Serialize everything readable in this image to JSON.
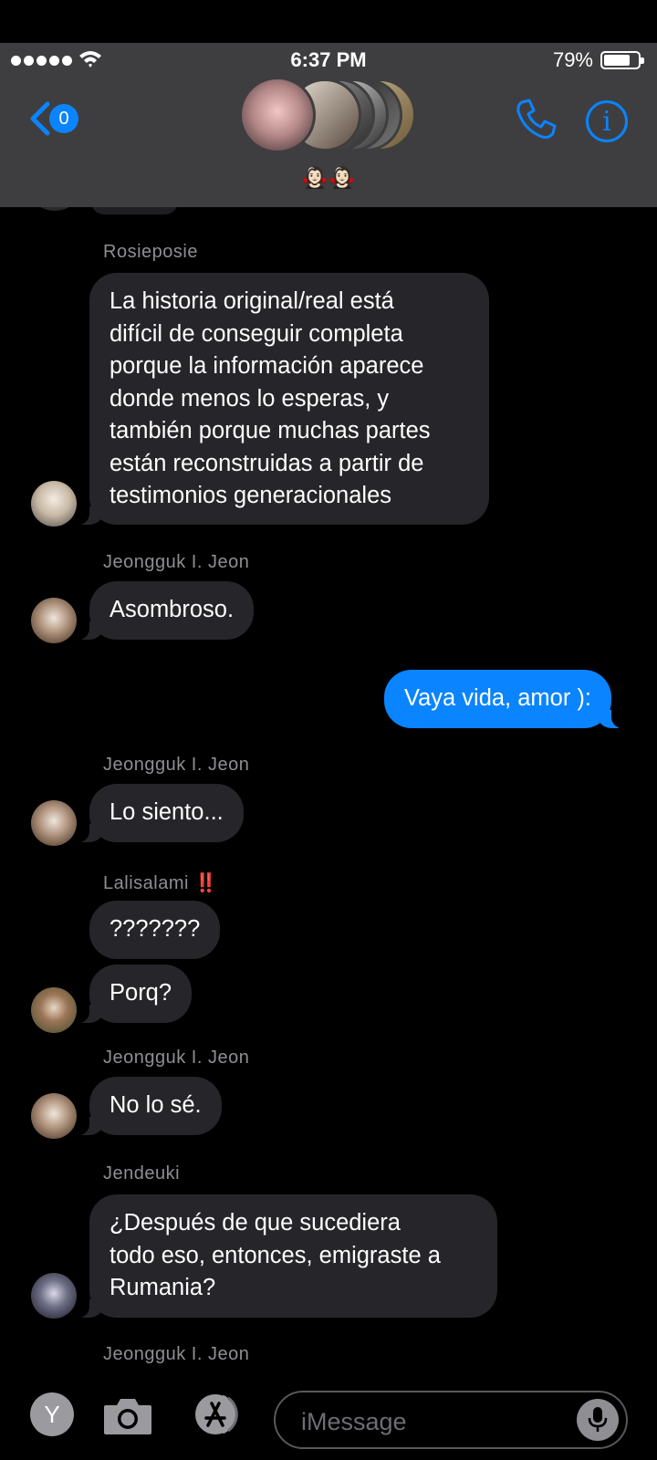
{
  "status": {
    "time": "6:37 PM",
    "battery": "79%",
    "battery_level": 0.79
  },
  "header": {
    "back_count": "0",
    "group_name": "🧛🏻‍♀️🧛🏻‍♀️"
  },
  "messages": [
    {
      "sender": "Rosieposie",
      "bubbles": [
        "La historia original/real está\ndifícil de conseguir completa\nporque la información aparece\ndonde menos lo esperas, y\ntambién porque muchas partes\nestán reconstruidas a partir de\ntestimonios generacionales"
      ]
    },
    {
      "sender": "Jeongguk I. Jeon",
      "bubbles": [
        "Asombroso."
      ]
    },
    {
      "outgoing": "Vaya vida, amor ):"
    },
    {
      "sender": "Jeongguk I. Jeon",
      "bubbles": [
        "Lo siento..."
      ]
    },
    {
      "sender": "Lalisalami",
      "sender_mark": "‼️",
      "bubbles": [
        "???????",
        "Porq?"
      ]
    },
    {
      "sender": "Jeongguk I. Jeon",
      "bubbles": [
        "No lo sé."
      ]
    },
    {
      "sender": "Jendeuki",
      "bubbles": [
        "¿Después de que sucediera\ntodo eso, entonces, emigraste a\nRumania?"
      ]
    },
    {
      "sender": "Jeongguk I. Jeon"
    }
  ],
  "compose": {
    "app_letter": "Y",
    "placeholder": "iMessage"
  },
  "colors": {
    "accent": "#0a84ff",
    "bubble_in": "#26252a",
    "header_bg": "#3e3e40"
  }
}
